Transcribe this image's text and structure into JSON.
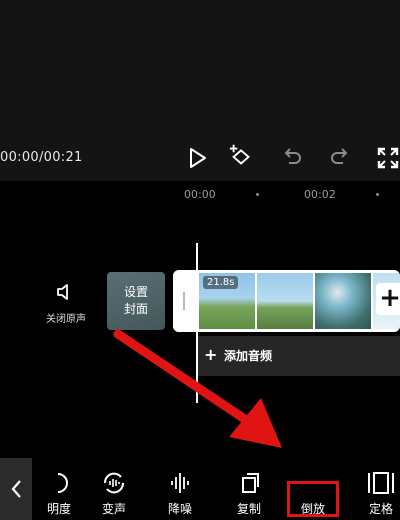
{
  "player": {
    "timecode": "00:00/00:21"
  },
  "timeline": {
    "ruler": [
      "00:00",
      "00:02"
    ],
    "mute_label": "关闭原声",
    "cover_label": "设置封面",
    "clip_duration": "21.8s",
    "add_clip_symbol": "+",
    "audio_add_symbol": "+",
    "audio_label": "添加音频"
  },
  "toolbar": {
    "items": [
      {
        "label": "明度",
        "icon": "brightness-icon"
      },
      {
        "label": "变声",
        "icon": "voice-change-icon"
      },
      {
        "label": "降噪",
        "icon": "noise-reduction-icon"
      },
      {
        "label": "复制",
        "icon": "copy-icon"
      },
      {
        "label": "倒放",
        "icon": "reverse-icon"
      },
      {
        "label": "定格",
        "icon": "freeze-frame-icon"
      }
    ]
  },
  "annotation": {
    "arrow_color": "#e11414",
    "highlight_color": "#e11414"
  }
}
